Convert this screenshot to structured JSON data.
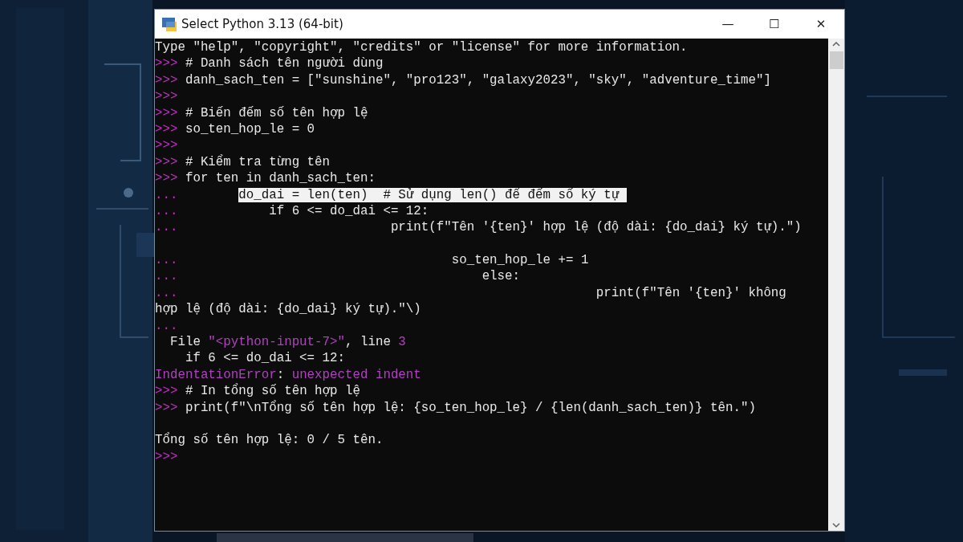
{
  "window": {
    "title": "Select Python 3.13 (64-bit)",
    "controls": [
      "—",
      "☐",
      "✕"
    ]
  },
  "console": {
    "lines": [
      {
        "kind": "text",
        "segments": [
          {
            "kind": "code",
            "text": "Type \"help\", \"copyright\", \"credits\" or \"license\" for more information."
          }
        ]
      },
      {
        "kind": "text",
        "segments": [
          {
            "kind": "prompt",
            "text": ">>>"
          },
          {
            "kind": "code",
            "text": " # Danh sách tên người dùng"
          }
        ]
      },
      {
        "kind": "text",
        "segments": [
          {
            "kind": "prompt",
            "text": ">>>"
          },
          {
            "kind": "code",
            "text": " danh_sach_ten = [\"sunshine\", \"pro123\", \"galaxy2023\", \"sky\", \"adventure_time\"]"
          }
        ]
      },
      {
        "kind": "text",
        "segments": [
          {
            "kind": "prompt",
            "text": ">>>"
          }
        ]
      },
      {
        "kind": "text",
        "segments": [
          {
            "kind": "prompt",
            "text": ">>>"
          },
          {
            "kind": "code",
            "text": " # Biến đếm số tên hợp lệ"
          }
        ]
      },
      {
        "kind": "text",
        "segments": [
          {
            "kind": "prompt",
            "text": ">>>"
          },
          {
            "kind": "code",
            "text": " so_ten_hop_le = 0"
          }
        ]
      },
      {
        "kind": "text",
        "segments": [
          {
            "kind": "prompt",
            "text": ">>>"
          }
        ]
      },
      {
        "kind": "text",
        "segments": [
          {
            "kind": "prompt",
            "text": ">>>"
          },
          {
            "kind": "code",
            "text": " # Kiểm tra từng tên"
          }
        ]
      },
      {
        "kind": "text",
        "segments": [
          {
            "kind": "prompt",
            "text": ">>>"
          },
          {
            "kind": "code",
            "text": " for ten in danh_sach_ten:"
          }
        ]
      },
      {
        "kind": "text",
        "segments": [
          {
            "kind": "prompt",
            "text": "...        "
          },
          {
            "kind": "selected",
            "text": "do_dai = len(ten)  # Sử dụng len() để đếm số ký tự "
          }
        ]
      },
      {
        "kind": "text",
        "segments": [
          {
            "kind": "prompt",
            "text": "..."
          },
          {
            "kind": "code",
            "text": "            if 6 <= do_dai <= 12:"
          }
        ]
      },
      {
        "kind": "text",
        "segments": [
          {
            "kind": "prompt",
            "text": "..."
          },
          {
            "kind": "code",
            "text": "                            print(f\"Tên '{ten}' hợp lệ (độ dài: {do_dai} ký tự).\")"
          }
        ]
      },
      {
        "kind": "blank"
      },
      {
        "kind": "text",
        "segments": [
          {
            "kind": "prompt",
            "text": "..."
          },
          {
            "kind": "code",
            "text": "                                    so_ten_hop_le += 1"
          }
        ]
      },
      {
        "kind": "text",
        "segments": [
          {
            "kind": "prompt",
            "text": "..."
          },
          {
            "kind": "code",
            "text": "                                        else:"
          }
        ]
      },
      {
        "kind": "text",
        "segments": [
          {
            "kind": "prompt",
            "text": "..."
          },
          {
            "kind": "code",
            "text": "                                                       print(f\"Tên '{ten}' không"
          }
        ]
      },
      {
        "kind": "text",
        "segments": [
          {
            "kind": "code",
            "text": "hợp lệ (độ dài: {do_dai} ký tự).\"\\)"
          }
        ]
      },
      {
        "kind": "text",
        "segments": [
          {
            "kind": "prompt",
            "text": "..."
          }
        ]
      },
      {
        "kind": "text",
        "segments": [
          {
            "kind": "code",
            "text": "  File "
          },
          {
            "kind": "string",
            "text": "\"<python-input-7>\""
          },
          {
            "kind": "code",
            "text": ", line "
          },
          {
            "kind": "string",
            "text": "3"
          }
        ]
      },
      {
        "kind": "text",
        "segments": [
          {
            "kind": "code",
            "text": "    if 6 <= do_dai <= 12:"
          }
        ]
      },
      {
        "kind": "text",
        "segments": [
          {
            "kind": "error",
            "text": "IndentationError"
          },
          {
            "kind": "code",
            "text": ": "
          },
          {
            "kind": "error",
            "text": "unexpected indent"
          }
        ]
      },
      {
        "kind": "text",
        "segments": [
          {
            "kind": "prompt",
            "text": ">>>"
          },
          {
            "kind": "code",
            "text": " # In tổng số tên hợp lệ"
          }
        ]
      },
      {
        "kind": "text",
        "segments": [
          {
            "kind": "prompt",
            "text": ">>>"
          },
          {
            "kind": "code",
            "text": " print(f\"\\nTổng số tên hợp lệ: {so_ten_hop_le} / {len(danh_sach_ten)} tên.\")"
          }
        ]
      },
      {
        "kind": "blank"
      },
      {
        "kind": "text",
        "segments": [
          {
            "kind": "code",
            "text": "Tổng số tên hợp lệ: 0 / 5 tên."
          }
        ]
      },
      {
        "kind": "text",
        "segments": [
          {
            "kind": "prompt",
            "text": ">>>"
          }
        ]
      }
    ]
  }
}
